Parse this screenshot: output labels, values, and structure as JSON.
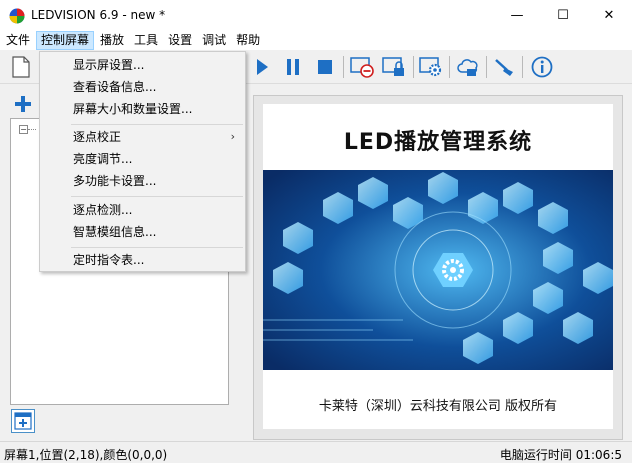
{
  "window": {
    "title": "LEDVISION 6.9 - new *",
    "minimize_glyph": "—",
    "maximize_glyph": "☐",
    "close_glyph": "✕"
  },
  "menubar": {
    "items": [
      {
        "label": "文件"
      },
      {
        "label": "控制屏幕",
        "active": true
      },
      {
        "label": "播放"
      },
      {
        "label": "工具"
      },
      {
        "label": "设置"
      },
      {
        "label": "调试"
      },
      {
        "label": "帮助"
      }
    ]
  },
  "dropdown": {
    "items": [
      {
        "label": "显示屏设置..."
      },
      {
        "label": "查看设备信息..."
      },
      {
        "label": "屏幕大小和数量设置..."
      },
      {
        "label": "逐点校正",
        "submenu_arrow": "›"
      },
      {
        "label": "亮度调节..."
      },
      {
        "label": "多功能卡设置..."
      },
      {
        "label": "逐点检测..."
      },
      {
        "label": "智慧模组信息..."
      },
      {
        "label": "定时指令表..."
      }
    ]
  },
  "toolbar": {
    "icons": [
      "new-file-icon",
      "play-icon",
      "pause-icon",
      "stop-icon",
      "screen-disable-icon",
      "screen-lock-icon",
      "screen-settings-icon",
      "cloud-icon",
      "brush-icon",
      "info-icon"
    ]
  },
  "preview": {
    "title": "LED播放管理系统",
    "footer": "卡莱特（深圳）云科技有限公司 版权所有"
  },
  "statusbar": {
    "left": "屏幕1,位置(2,18),颜色(0,0,0)",
    "right": "电脑运行时间 01:06:5"
  },
  "colors": {
    "accent": "#1e6fc4",
    "menu_highlight": "#cce8ff",
    "hex_blue": "#3aa9f0"
  }
}
